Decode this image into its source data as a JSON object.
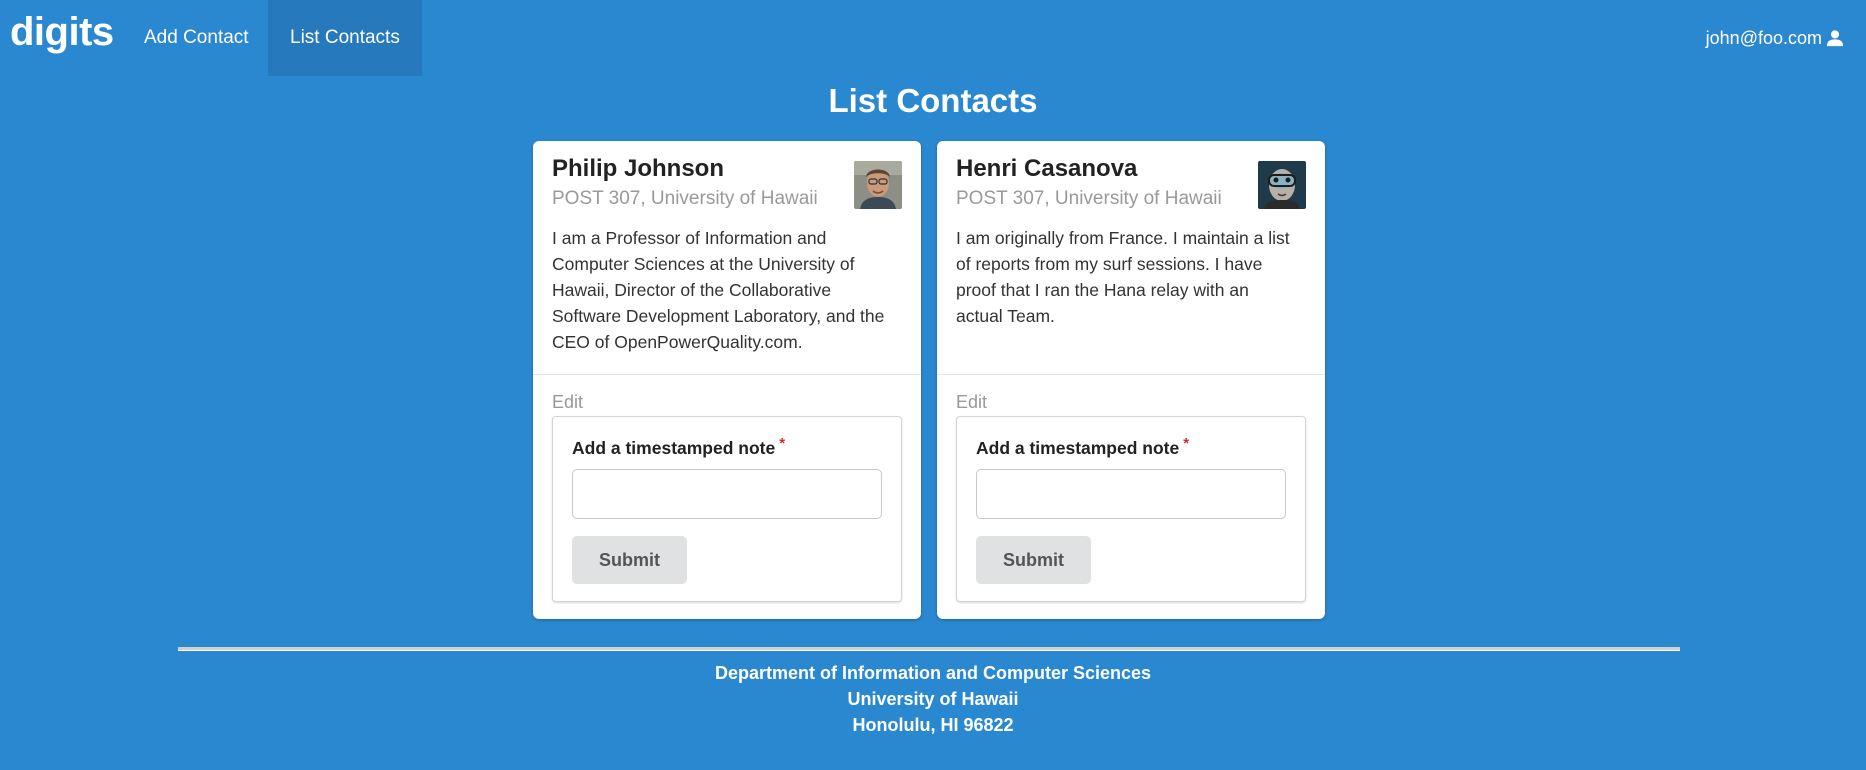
{
  "nav": {
    "brand": "digits",
    "items": [
      {
        "label": "Add Contact",
        "active": false
      },
      {
        "label": "List Contacts",
        "active": true
      }
    ],
    "user": "john@foo.com",
    "user_icon": "user-icon"
  },
  "page": {
    "title": "List Contacts"
  },
  "contacts": [
    {
      "name": "Philip Johnson",
      "address": "POST 307, University of Hawaii",
      "description": "I am a Professor of Information and Computer Sciences at the University of Hawaii, Director of the Collaborative Software Development Laboratory, and the CEO of OpenPowerQuality.com.",
      "edit_label": "Edit",
      "note_label": "Add a timestamped note",
      "required_mark": "*",
      "note_value": "",
      "submit_label": "Submit"
    },
    {
      "name": "Henri Casanova",
      "address": "POST 307, University of Hawaii",
      "description": "I am originally from France. I maintain a list of reports from my surf sessions. I have proof that I ran the Hana relay with an actual Team.",
      "edit_label": "Edit",
      "note_label": "Add a timestamped note",
      "required_mark": "*",
      "note_value": "",
      "submit_label": "Submit"
    }
  ],
  "footer": {
    "line1": "Department of Information and Computer Sciences",
    "line2": "University of Hawaii",
    "line3": "Honolulu, HI 96822"
  },
  "colors": {
    "background": "#2a88d0",
    "active_nav": "#2679bd",
    "required": "#db2828",
    "button": "#e0e1e2"
  }
}
